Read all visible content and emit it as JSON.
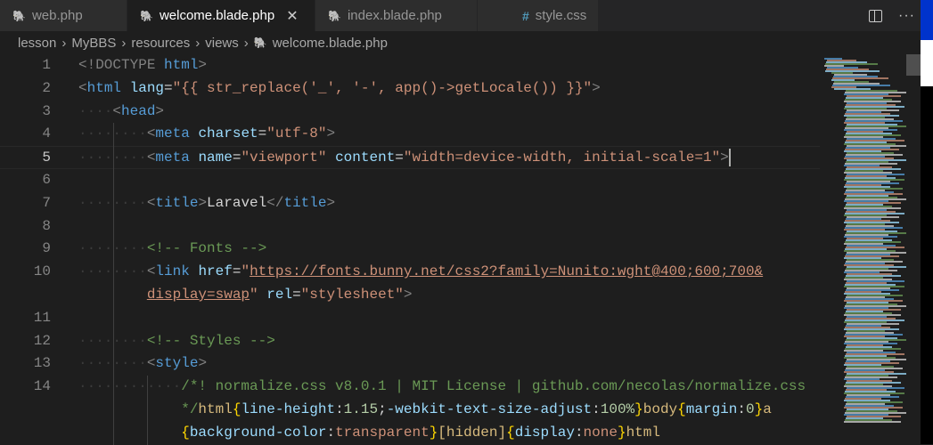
{
  "tabs": [
    {
      "label": "web.php",
      "icon": "php-elephant-icon"
    },
    {
      "label": "welcome.blade.php",
      "icon": "php-elephant-icon",
      "active": true,
      "close": "✕"
    },
    {
      "label": "index.blade.php",
      "icon": "php-elephant-icon"
    },
    {
      "label": "style.css",
      "icon": "css-hash-icon"
    }
  ],
  "breadcrumb": [
    "lesson",
    "MyBBS",
    "resources",
    "views",
    "welcome.blade.php"
  ],
  "colors": {
    "tag": "#569cd6",
    "attr": "#9cdcfe",
    "string": "#ce9178",
    "comment": "#6a9955",
    "background": "#1e1e1e"
  },
  "lines": [
    {
      "n": "1",
      "indent": 0,
      "t": [
        [
          "<!DOCTYPE ",
          "br"
        ],
        [
          "html",
          "tg"
        ],
        [
          ">",
          "br"
        ]
      ]
    },
    {
      "n": "2",
      "indent": 0,
      "t": [
        [
          "<",
          "br"
        ],
        [
          "html",
          "tg"
        ],
        [
          " ",
          ""
        ],
        [
          "lang",
          "at"
        ],
        [
          "=",
          "tx"
        ],
        [
          "\"{{ str_replace('_', '-', app()->getLocale()) }}\"",
          "st"
        ],
        [
          ">",
          "br"
        ]
      ]
    },
    {
      "n": "3",
      "indent": 1,
      "t": [
        [
          "<",
          "br"
        ],
        [
          "head",
          "tg"
        ],
        [
          ">",
          "br"
        ]
      ]
    },
    {
      "n": "4",
      "indent": 2,
      "t": [
        [
          "<",
          "br"
        ],
        [
          "meta",
          "tg"
        ],
        [
          " ",
          ""
        ],
        [
          "charset",
          "at"
        ],
        [
          "=",
          "tx"
        ],
        [
          "\"utf-8\"",
          "st"
        ],
        [
          ">",
          "br"
        ]
      ]
    },
    {
      "n": "5",
      "indent": 2,
      "cur": true,
      "t": [
        [
          "<",
          "br"
        ],
        [
          "meta",
          "tg"
        ],
        [
          " ",
          ""
        ],
        [
          "name",
          "at"
        ],
        [
          "=",
          "tx"
        ],
        [
          "\"viewport\"",
          "st"
        ],
        [
          " ",
          ""
        ],
        [
          "content",
          "at"
        ],
        [
          "=",
          "tx"
        ],
        [
          "\"width=device-width, initial-scale=1\"",
          "st"
        ],
        [
          ">",
          "br"
        ]
      ]
    },
    {
      "n": "6",
      "indent": 0,
      "t": []
    },
    {
      "n": "7",
      "indent": 2,
      "t": [
        [
          "<",
          "br"
        ],
        [
          "title",
          "tg"
        ],
        [
          ">",
          "br"
        ],
        [
          "Laravel",
          "tx"
        ],
        [
          "</",
          "br"
        ],
        [
          "title",
          "tg"
        ],
        [
          ">",
          "br"
        ]
      ]
    },
    {
      "n": "8",
      "indent": 0,
      "t": []
    },
    {
      "n": "9",
      "indent": 2,
      "t": [
        [
          "<!-- Fonts -->",
          "cm"
        ]
      ]
    },
    {
      "n": "10",
      "indent": 2,
      "t": [
        [
          "<",
          "br"
        ],
        [
          "link",
          "tg"
        ],
        [
          " ",
          ""
        ],
        [
          "href",
          "at"
        ],
        [
          "=",
          "tx"
        ],
        [
          "\"",
          "st"
        ],
        [
          "https://fonts.bunny.net/css2?family=Nunito:wght@400;600;700&",
          "st ul"
        ]
      ]
    },
    {
      "n": "",
      "indent": 2,
      "wrap": true,
      "t": [
        [
          "display=swap",
          "st ul"
        ],
        [
          "\"",
          "st"
        ],
        [
          " ",
          ""
        ],
        [
          "rel",
          "at"
        ],
        [
          "=",
          "tx"
        ],
        [
          "\"stylesheet\"",
          "st"
        ],
        [
          ">",
          "br"
        ]
      ]
    },
    {
      "n": "11",
      "indent": 0,
      "t": []
    },
    {
      "n": "12",
      "indent": 2,
      "t": [
        [
          "<!-- Styles -->",
          "cm"
        ]
      ]
    },
    {
      "n": "13",
      "indent": 2,
      "t": [
        [
          "<",
          "br"
        ],
        [
          "style",
          "tg"
        ],
        [
          ">",
          "br"
        ]
      ]
    },
    {
      "n": "14",
      "indent": 3,
      "t": [
        [
          "/*! normalize.css v8.0.1 | MIT License | github.com/necolas/normalize.css",
          "cm"
        ]
      ]
    },
    {
      "n": "",
      "indent": 3,
      "wrap": true,
      "t": [
        [
          "*/",
          "cm"
        ],
        [
          "html",
          "sl"
        ],
        [
          "{",
          "yb"
        ],
        [
          "line-height",
          "pp"
        ],
        [
          ":",
          "tx"
        ],
        [
          "1.15",
          "nm"
        ],
        [
          ";",
          "tx"
        ],
        [
          "-webkit-text-size-adjust",
          "pp"
        ],
        [
          ":",
          "tx"
        ],
        [
          "100%",
          "nm"
        ],
        [
          "}",
          "yb"
        ],
        [
          "body",
          "sl"
        ],
        [
          "{",
          "yb"
        ],
        [
          "margin",
          "pp"
        ],
        [
          ":",
          "tx"
        ],
        [
          "0",
          "nm"
        ],
        [
          "}",
          "yb"
        ],
        [
          "a",
          "sl"
        ]
      ]
    },
    {
      "n": "",
      "indent": 3,
      "wrap": true,
      "t": [
        [
          "{",
          "yb"
        ],
        [
          "background-color",
          "pp"
        ],
        [
          ":",
          "tx"
        ],
        [
          "transparent",
          "st"
        ],
        [
          "}",
          "yb"
        ],
        [
          "[hidden]",
          "sl"
        ],
        [
          "{",
          "yb"
        ],
        [
          "display",
          "pp"
        ],
        [
          ":",
          "tx"
        ],
        [
          "none",
          "st"
        ],
        [
          "}",
          "yb"
        ],
        [
          "html",
          "sl"
        ]
      ]
    }
  ]
}
